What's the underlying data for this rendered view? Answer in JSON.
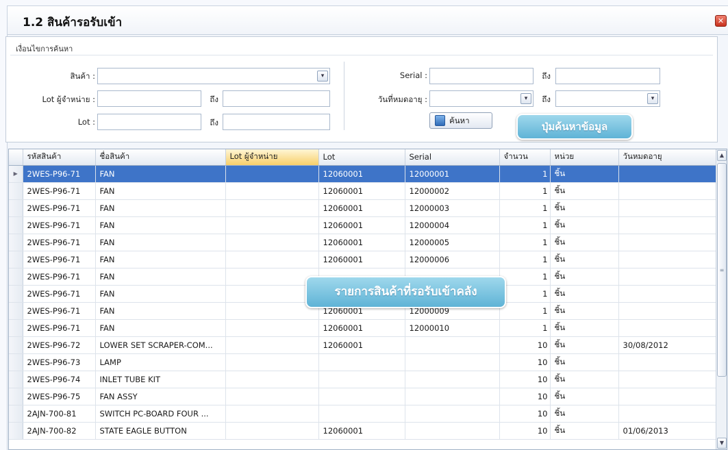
{
  "window": {
    "title": "1.2 สินค้ารอรับเข้า",
    "close_icon": "close-icon"
  },
  "search": {
    "group_title": "เงื่อนไขการค้นหา",
    "product_label": "สินค้า :",
    "lot_label": "Lot ผู้จำหน่าย :",
    "lot2_label": "Lot :",
    "to_label": "ถึง",
    "serial_label": "Serial :",
    "expiry_label": "วันที่หมดอายุ :",
    "search_button": "ค้นหา"
  },
  "callouts": {
    "search_hint": "ปุ่มค้นหาข้อมูล",
    "list_hint": "รายการสินค้าที่รอรับเข้าคลัง"
  },
  "grid": {
    "columns": [
      "รหัสสินค้า",
      "ชื่อสินค้า",
      "Lot ผู้จำหน่าย",
      "Lot",
      "Serial",
      "จำนวน",
      "หน่วย",
      "วันหมดอายุ"
    ],
    "rows": [
      [
        "2WES-P96-71",
        "FAN",
        "",
        "12060001",
        "12000001",
        "1",
        "ชิ้น",
        ""
      ],
      [
        "2WES-P96-71",
        "FAN",
        "",
        "12060001",
        "12000002",
        "1",
        "ชิ้น",
        ""
      ],
      [
        "2WES-P96-71",
        "FAN",
        "",
        "12060001",
        "12000003",
        "1",
        "ชิ้น",
        ""
      ],
      [
        "2WES-P96-71",
        "FAN",
        "",
        "12060001",
        "12000004",
        "1",
        "ชิ้น",
        ""
      ],
      [
        "2WES-P96-71",
        "FAN",
        "",
        "12060001",
        "12000005",
        "1",
        "ชิ้น",
        ""
      ],
      [
        "2WES-P96-71",
        "FAN",
        "",
        "12060001",
        "12000006",
        "1",
        "ชิ้น",
        ""
      ],
      [
        "2WES-P96-71",
        "FAN",
        "",
        "",
        "",
        "1",
        "ชิ้น",
        ""
      ],
      [
        "2WES-P96-71",
        "FAN",
        "",
        "",
        "",
        "1",
        "ชิ้น",
        ""
      ],
      [
        "2WES-P96-71",
        "FAN",
        "",
        "12060001",
        "12000009",
        "1",
        "ชิ้น",
        ""
      ],
      [
        "2WES-P96-71",
        "FAN",
        "",
        "12060001",
        "12000010",
        "1",
        "ชิ้น",
        ""
      ],
      [
        "2WES-P96-72",
        "LOWER SET SCRAPER-COM...",
        "",
        "12060001",
        "",
        "10",
        "ชิ้น",
        "30/08/2012"
      ],
      [
        "2WES-P96-73",
        "LAMP",
        "",
        "",
        "",
        "10",
        "ชิ้น",
        ""
      ],
      [
        "2WES-P96-74",
        "INLET TUBE KIT",
        "",
        "",
        "",
        "10",
        "ชิ้น",
        ""
      ],
      [
        "2WES-P96-75",
        "FAN ASSY",
        "",
        "",
        "",
        "10",
        "ชิ้น",
        ""
      ],
      [
        "2AJN-700-81",
        "SWITCH PC-BOARD FOUR ...",
        "",
        "",
        "",
        "10",
        "ชิ้น",
        ""
      ],
      [
        "2AJN-700-82",
        "STATE EAGLE BUTTON",
        "",
        "12060001",
        "",
        "10",
        "ชิ้น",
        "01/06/2013"
      ]
    ]
  }
}
